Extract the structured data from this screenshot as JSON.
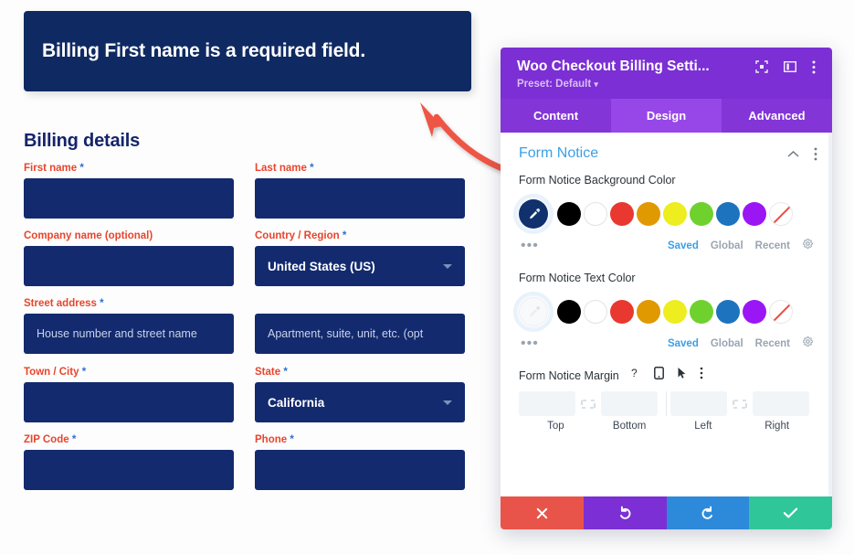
{
  "checkout": {
    "notice": "Billing First name is a required field.",
    "notice_bg": "#0f2a62",
    "heading": "Billing details",
    "fields": [
      {
        "label": "First name",
        "required": true,
        "type": "input",
        "value": "",
        "placeholder": ""
      },
      {
        "label": "Last name",
        "required": true,
        "type": "input",
        "value": "",
        "placeholder": ""
      },
      {
        "label": "Company name (optional)",
        "required": false,
        "type": "input",
        "value": "",
        "placeholder": ""
      },
      {
        "label": "Country / Region",
        "required": true,
        "type": "select",
        "value": "United States (US)"
      },
      {
        "label": "Street address",
        "required": true,
        "type": "input",
        "value": "",
        "placeholder": "House number and street name"
      },
      {
        "label": "",
        "required": false,
        "type": "input",
        "value": "",
        "placeholder": "Apartment, suite, unit, etc. (opt"
      },
      {
        "label": "Town / City",
        "required": true,
        "type": "input",
        "value": "",
        "placeholder": ""
      },
      {
        "label": "State",
        "required": true,
        "type": "select",
        "value": "California"
      },
      {
        "label": "ZIP Code",
        "required": true,
        "type": "input",
        "value": "",
        "placeholder": ""
      },
      {
        "label": "Phone",
        "required": true,
        "type": "input",
        "value": "",
        "placeholder": ""
      }
    ],
    "required_marker": "*",
    "label_color": "#e8452c",
    "input_bg": "#132a6e"
  },
  "panel": {
    "title": "Woo Checkout Billing Setti...",
    "preset": "Preset: Default",
    "preset_caret": "▾",
    "header_icons": [
      "focus-icon",
      "layout-icon",
      "kebab-menu-icon"
    ],
    "tabs": [
      {
        "label": "Content",
        "active": false
      },
      {
        "label": "Design",
        "active": true
      },
      {
        "label": "Advanced",
        "active": false
      }
    ],
    "section": {
      "title": "Form Notice",
      "collapse_icon": "chevron-up-icon",
      "menu_icon": "kebab-menu-icon"
    },
    "bg_color_field": {
      "label": "Form Notice Background Color",
      "selected_color": "#10306e",
      "selected_icon": "eyedropper-icon",
      "swatches": [
        "#000000",
        "#ffffff",
        "#e8382f",
        "#e09900",
        "#eded1f",
        "#6fd12e",
        "#1e73be",
        "#9b16f4",
        "transparent"
      ],
      "more_dots": "•••",
      "tabs": [
        {
          "label": "Saved",
          "active": true
        },
        {
          "label": "Global",
          "active": false
        },
        {
          "label": "Recent",
          "active": false
        }
      ],
      "settings_icon": "gear-icon"
    },
    "text_color_field": {
      "label": "Form Notice Text Color",
      "selected_color": "#f7f9fb",
      "selected_icon": "eyedropper-icon",
      "swatches": [
        "#000000",
        "#ffffff",
        "#e8382f",
        "#e09900",
        "#eded1f",
        "#6fd12e",
        "#1e73be",
        "#9b16f4",
        "transparent"
      ],
      "more_dots": "•••",
      "tabs": [
        {
          "label": "Saved",
          "active": true
        },
        {
          "label": "Global",
          "active": false
        },
        {
          "label": "Recent",
          "active": false
        }
      ],
      "settings_icon": "gear-icon"
    },
    "margin_field": {
      "label": "Form Notice Margin",
      "icons": [
        "help-icon",
        "responsive-mobile-icon",
        "hover-cursor-icon",
        "kebab-menu-icon"
      ],
      "link_icon": "link-toggle-icon",
      "inputs": [
        {
          "name": "Top",
          "value": ""
        },
        {
          "name": "Bottom",
          "value": ""
        },
        {
          "name": "Left",
          "value": ""
        },
        {
          "name": "Right",
          "value": ""
        }
      ]
    },
    "footer_buttons": [
      {
        "name": "cancel-button",
        "icon": "close-x-icon",
        "color": "#e8544a"
      },
      {
        "name": "undo-button",
        "icon": "undo-icon",
        "color": "#7b2fd4"
      },
      {
        "name": "redo-button",
        "icon": "redo-icon",
        "color": "#2d8ada"
      },
      {
        "name": "save-button",
        "icon": "checkmark-icon",
        "color": "#2fc79a"
      }
    ]
  },
  "annotation": {
    "arrow_color": "#ef5544"
  }
}
